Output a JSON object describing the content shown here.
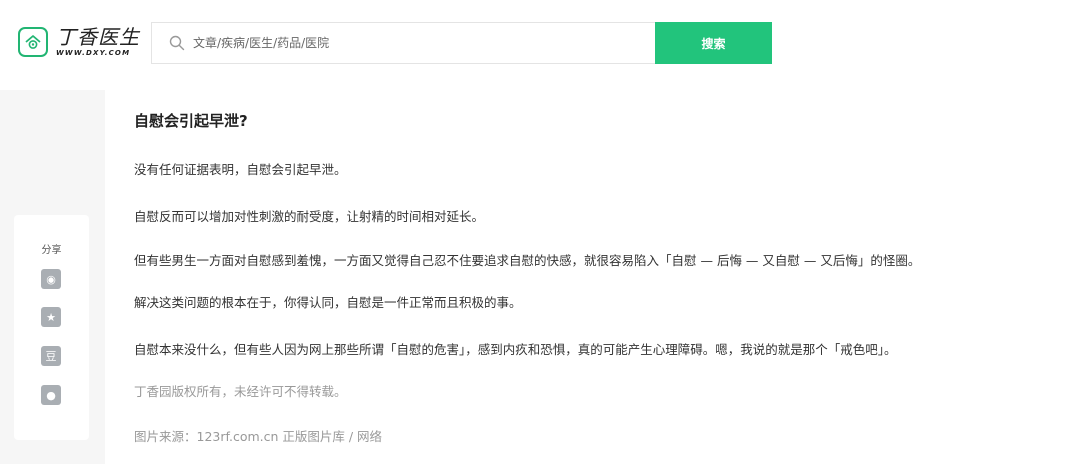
{
  "header": {
    "logo_cn": "丁香医生",
    "logo_en": "WWW.DXY.COM",
    "search_placeholder": "文章/疾病/医生/药品/医院",
    "search_button": "搜索"
  },
  "share": {
    "title": "分享",
    "items": [
      {
        "icon": "weibo-icon",
        "glyph": "◉"
      },
      {
        "icon": "qzone-star-icon",
        "glyph": "★"
      },
      {
        "icon": "douban-icon",
        "glyph": "豆"
      },
      {
        "icon": "wechat-icon",
        "glyph": "●"
      }
    ]
  },
  "article": {
    "title": "自慰会引起早泄?",
    "paragraphs": [
      "没有任何证据表明，自慰会引起早泄。",
      "自慰反而可以增加对性刺激的耐受度，让射精的时间相对延长。",
      "但有些男生一方面对自慰感到羞愧，一方面又觉得自己忍不住要追求自慰的快感，就很容易陷入「自慰 — 后悔 — 又自慰 — 又后悔」的怪圈。",
      "解决这类问题的根本在于，你得认同，自慰是一件正常而且积极的事。",
      "自慰本来没什么，但有些人因为网上那些所谓「自慰的危害」，感到内疚和恐惧，真的可能产生心理障碍。嗯，我说的就是那个「戒色吧」。"
    ],
    "copyright": "丁香园版权所有，未经许可不得转载。",
    "image_source": "图片来源：123rf.com.cn 正版图片库 / 网络"
  },
  "colors": {
    "brand_green": "#22c47c",
    "logo_green": "#22b573",
    "panel_bg": "#f6f6f6"
  }
}
